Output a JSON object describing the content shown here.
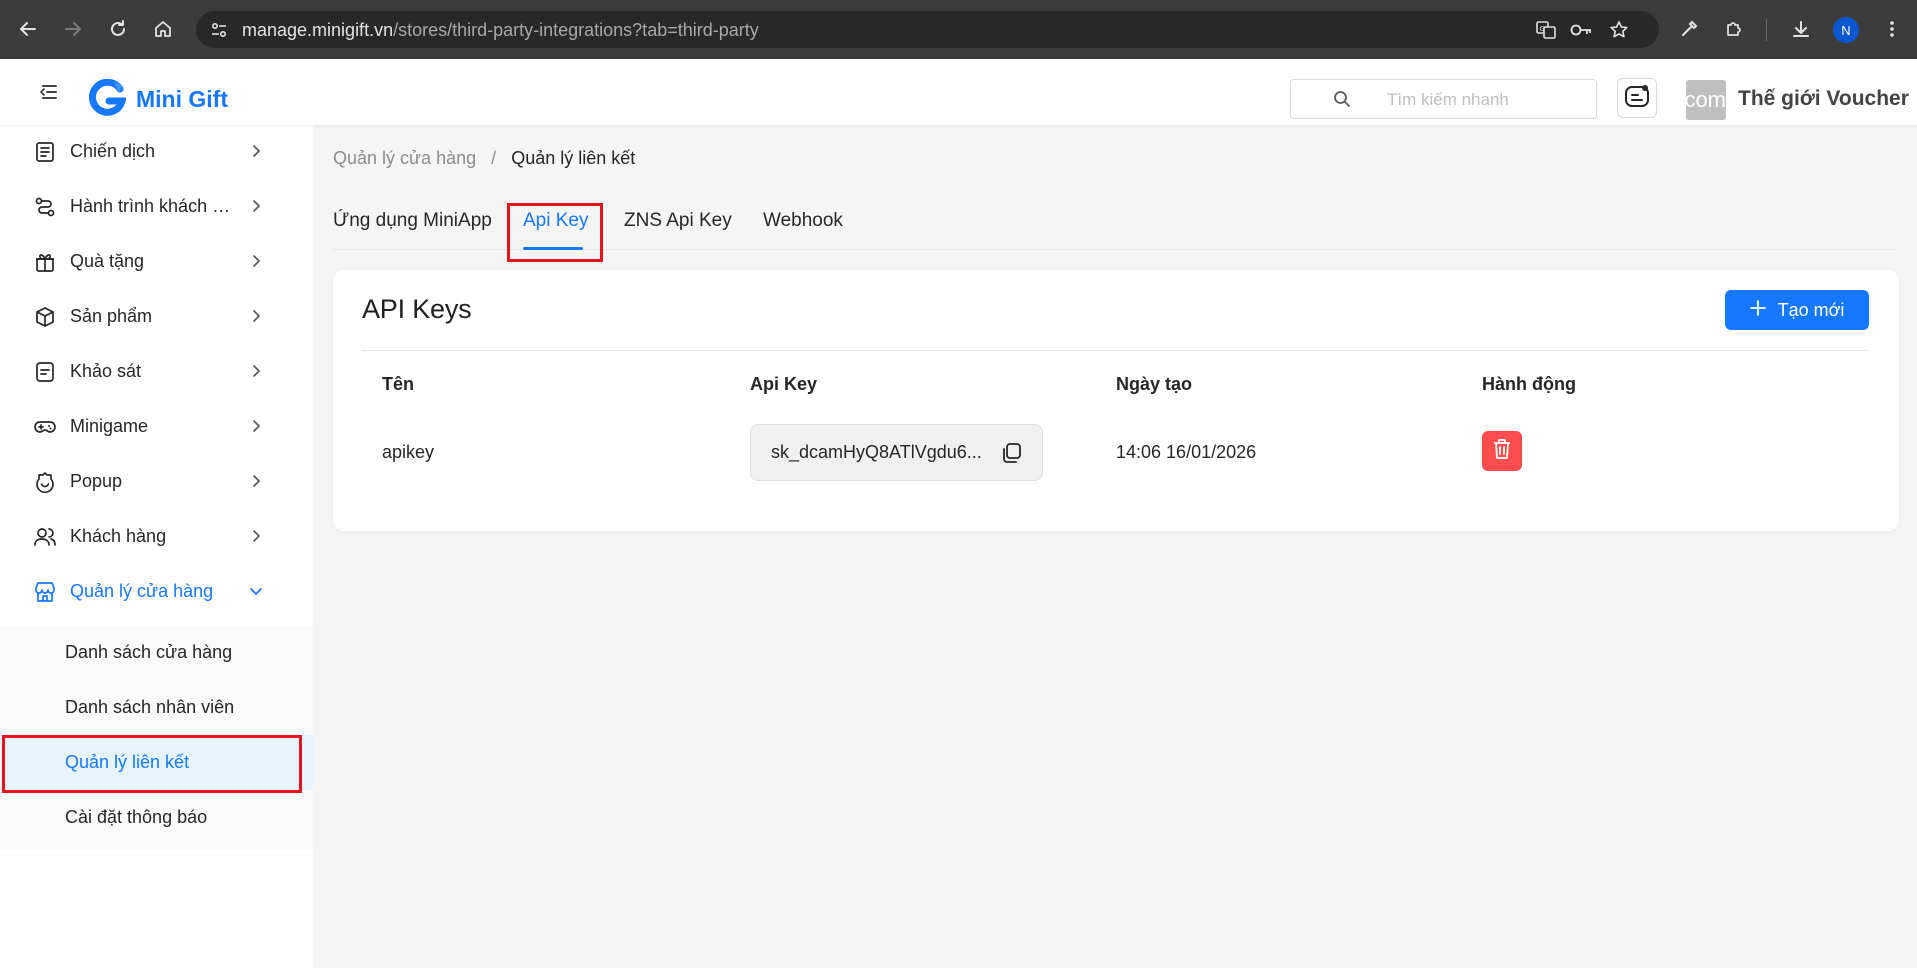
{
  "browser": {
    "url_host": "manage.minigift.vn",
    "url_path": "/stores/third-party-integrations?tab=third-party",
    "profile_initial": "N"
  },
  "header": {
    "logo_text": "Mini Gift",
    "search_placeholder": "Tìm kiếm nhanh",
    "store_avatar_text": "com",
    "store_name": "Thế giới Voucher"
  },
  "sidebar": {
    "items": [
      {
        "label": "Chiến dịch",
        "icon": "campaign-icon"
      },
      {
        "label": "Hành trình khách hàng",
        "icon": "journey-icon"
      },
      {
        "label": "Quà tặng",
        "icon": "gift-icon"
      },
      {
        "label": "Sản phẩm",
        "icon": "product-box-icon"
      },
      {
        "label": "Khảo sát",
        "icon": "survey-icon"
      },
      {
        "label": "Minigame",
        "icon": "gamepad-icon"
      },
      {
        "label": "Popup",
        "icon": "popup-icon"
      },
      {
        "label": "Khách hàng",
        "icon": "customers-icon"
      },
      {
        "label": "Quản lý cửa hàng",
        "icon": "store-icon"
      }
    ],
    "submenu": [
      {
        "label": "Danh sách cửa hàng"
      },
      {
        "label": "Danh sách nhân viên"
      },
      {
        "label": "Quản lý liên kết"
      },
      {
        "label": "Cài đặt thông báo"
      }
    ]
  },
  "breadcrumb": {
    "parent": "Quản lý cửa hàng",
    "separator": "/",
    "current": "Quản lý liên kết"
  },
  "tabs": [
    {
      "label": "Ứng dụng MiniApp"
    },
    {
      "label": "Api Key"
    },
    {
      "label": "ZNS Api Key"
    },
    {
      "label": "Webhook"
    }
  ],
  "card": {
    "title": "API Keys",
    "create_label": "Tạo mới",
    "columns": [
      "Tên",
      "Api Key",
      "Ngày tạo",
      "Hành động"
    ],
    "rows": [
      {
        "name": "apikey",
        "api_key": "sk_dcamHyQ8ATlVgdu6...",
        "created": "14:06 16/01/2026"
      }
    ]
  },
  "colors": {
    "accent": "#1677ff",
    "danger": "#ff4d4f",
    "highlight": "#e8131b"
  }
}
